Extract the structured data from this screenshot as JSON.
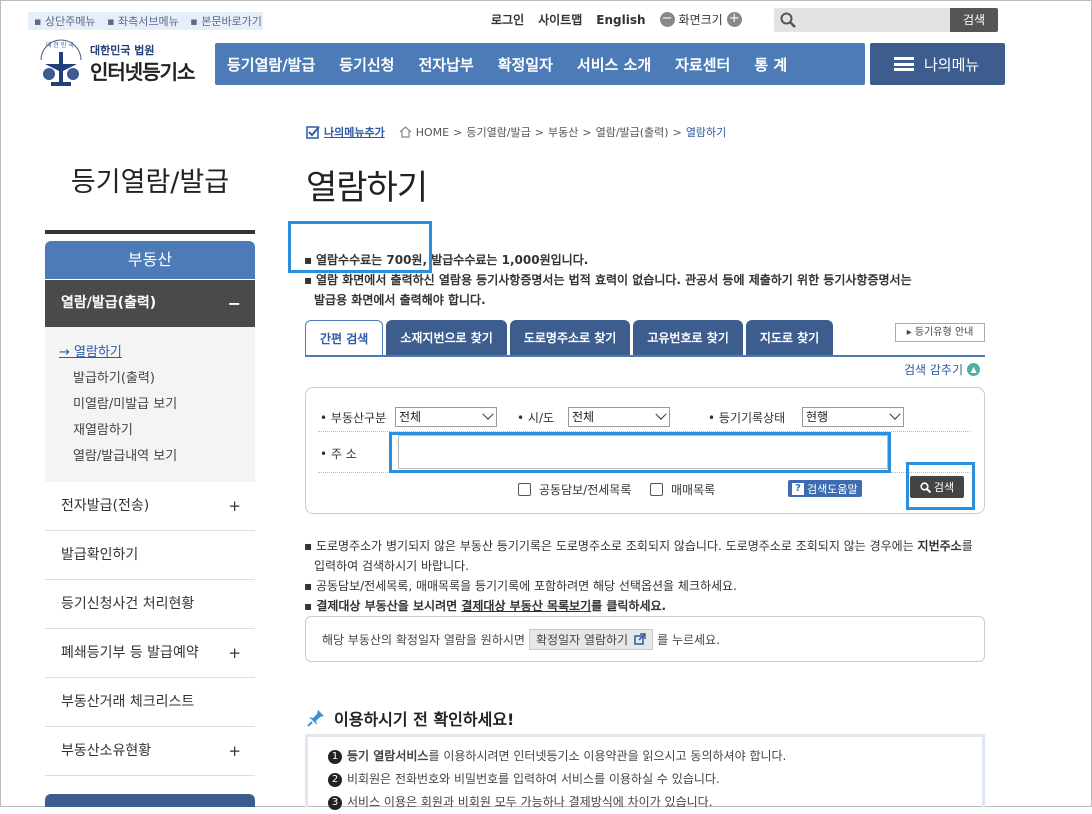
{
  "top": {
    "skip_links": [
      "상단주메뉴",
      "좌측서브메뉴",
      "본문바로가기"
    ],
    "login": "로그인",
    "sitemap": "사이트맵",
    "english": "English",
    "font_size": "화면크기",
    "search_placeholder": "",
    "search_button": "검색"
  },
  "logo": {
    "small": "대한민국 법원",
    "big": "인터넷등기소",
    "emblem_text": "대한민국법원"
  },
  "nav": {
    "items": [
      "등기열람/발급",
      "등기신청",
      "전자납부",
      "확정일자",
      "서비스 소개",
      "자료센터",
      "통 계"
    ],
    "my_menu": "나의메뉴"
  },
  "sidebar": {
    "title": "등기열람/발급",
    "section": "부동산",
    "selected": "열람/발급(출력)",
    "selected_toggle": "−",
    "sub_items": [
      "열람하기",
      "발급하기(출력)",
      "미열람/미발급 보기",
      "재열람하기",
      "열람/발급내역 보기"
    ],
    "items": [
      {
        "label": "전자발급(전송)",
        "toggle": "+"
      },
      {
        "label": "발급확인하기",
        "toggle": ""
      },
      {
        "label": "등기신청사건 처리현황",
        "toggle": ""
      },
      {
        "label": "폐쇄등기부 등 발급예약",
        "toggle": "+"
      },
      {
        "label": "부동산거래 체크리스트",
        "toggle": ""
      },
      {
        "label": "부동산소유현황",
        "toggle": "+"
      }
    ]
  },
  "breadcrumb": {
    "add": "나의메뉴추가",
    "path": [
      "HOME",
      "등기열람/발급",
      "부동산",
      "열람/발급(출력)"
    ],
    "current": "열람하기",
    "sep": ">"
  },
  "page_title": "열람하기",
  "fee_notes": {
    "line1": "열람수수료는 700원, 발급수수료는 1,000원입니다.",
    "line2a": "열람 화면에서 출력하신 열람용 등기사항증명서는 법적 효력이 없습니다. 관공서 등에 제출하기 위한 등기사항증명서는",
    "line2b": "발급용 화면에서 출력해야 합니다."
  },
  "tabs": [
    "간편 검색",
    "소재지번으로 찾기",
    "도로명주소로 찾기",
    "고유번호로 찾기",
    "지도로 찾기"
  ],
  "guide_button": "등기유형 안내",
  "fold_label": "검색 감추기",
  "form": {
    "type_label": "부동산구분",
    "type_value": "전체",
    "sido_label": "시/도",
    "sido_value": "전체",
    "state_label": "등기기록상태",
    "state_value": "현행",
    "addr_label": "주 소",
    "addr_value": "",
    "chk1": "공동담보/전세목록",
    "chk2": "매매목록",
    "help": "검색도움말",
    "search": "검색"
  },
  "notes2": {
    "line1a": "도로명주소가 병기되지 않은 부동산 등기기록은 도로명주소로 조회되지 않습니다. 도로명주소로 조회되지 않는 경우에는 ",
    "line1b": "지번주소",
    "line1c": "를",
    "line1d": "입력하여 검색하시기 바랍니다.",
    "line2": "공동담보/전세목록, 매매목록을 등기기록에 포함하려면 해당 선택옵션을 체크하세요.",
    "line3a": "결제대상 부동산을 보시려면 ",
    "line3b": "결제대상 부동산 목록보기",
    "line3c": "를 클릭하세요."
  },
  "confirm": {
    "text1": "해당 부동산의 확정일자 열람을 원하시면",
    "button": "확정일자 열람하기",
    "text2": "를 누르세요."
  },
  "before": {
    "title": "이용하시기 전 확인하세요!",
    "n1": "1",
    "b1": "등기 열람서비스",
    "t1": "를 이용하시려면 인터넷등기소 이용약관을 읽으시고 동의하셔야 합니다.",
    "n2": "2",
    "t2": "비회원은 전화번호와 비밀번호를 입력하여 서비스를 이용하실 수 있습니다.",
    "n3": "3",
    "t3": "서비스 이용은 회원과 비회원 모두 가능하나 결제방식에 차이가 있습니다."
  }
}
